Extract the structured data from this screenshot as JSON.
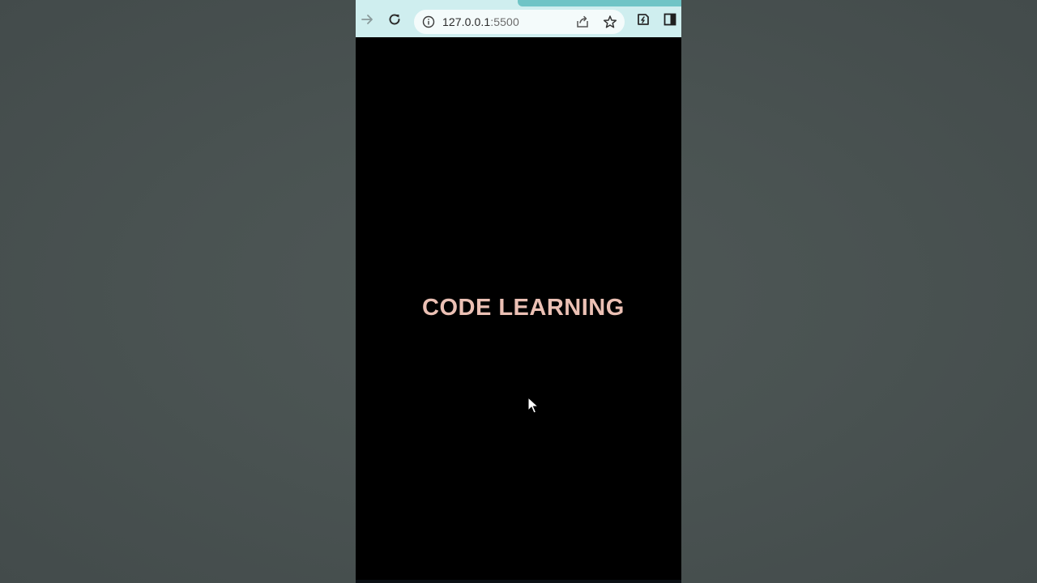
{
  "browser": {
    "url_host": "127.0.0.1",
    "url_port": ":5500",
    "icons": {
      "forward": "arrow-right-icon",
      "reload": "reload-icon",
      "info": "info-icon",
      "share": "share-icon",
      "bookmark": "star-icon",
      "extensions": "extensions-icon",
      "side_panel": "side-panel-icon"
    }
  },
  "page": {
    "headline": "CODE LEARNING"
  },
  "colors": {
    "headline": "#ebc0b4",
    "page_background": "#000000",
    "toolbar": "#cfeeef",
    "backdrop": "#4a5352"
  }
}
